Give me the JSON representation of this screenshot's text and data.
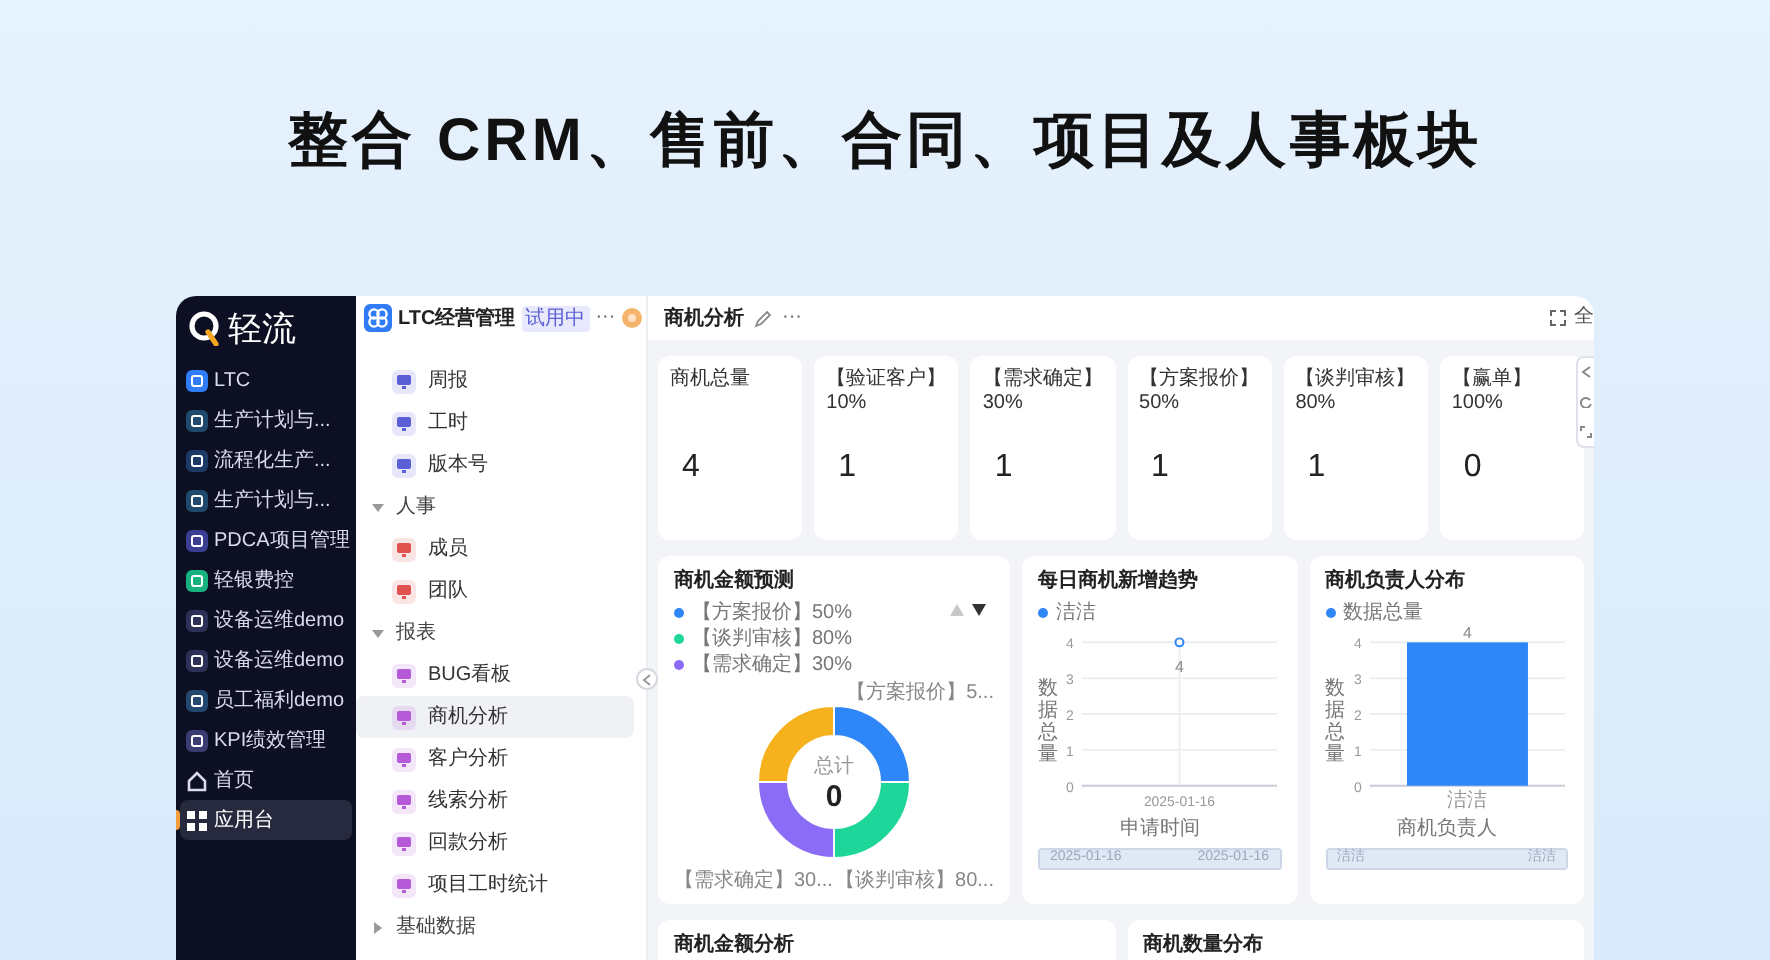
{
  "headline": "整合 CRM、售前、合同、项目及人事板块",
  "brand": "轻流",
  "apps": [
    {
      "label": "LTC",
      "kind": "app",
      "color": "#2f7cf6",
      "selected": false
    },
    {
      "label": "生产计划与...",
      "kind": "app",
      "color": "#1f4a6e",
      "selected": false
    },
    {
      "label": "流程化生产...",
      "kind": "app",
      "color": "#1c3a66",
      "selected": false
    },
    {
      "label": "生产计划与...",
      "kind": "app",
      "color": "#1f4a6e",
      "selected": false
    },
    {
      "label": "PDCA项目管理",
      "kind": "app",
      "color": "#3a3f93",
      "selected": false
    },
    {
      "label": "轻银费控",
      "kind": "app",
      "color": "#17b17f",
      "selected": false
    },
    {
      "label": "设备运维demo",
      "kind": "app",
      "color": "#2d3158",
      "selected": false
    },
    {
      "label": "设备运维demo",
      "kind": "app",
      "color": "#2d3158",
      "selected": false
    },
    {
      "label": "员工福利demo",
      "kind": "app",
      "color": "#23476e",
      "selected": false
    },
    {
      "label": "KPI绩效管理",
      "kind": "app",
      "color": "#3a3d72",
      "selected": false
    },
    {
      "label": "首页",
      "kind": "home",
      "selected": false
    },
    {
      "label": "应用台",
      "kind": "grid",
      "selected": true
    }
  ],
  "nav": {
    "title": "LTC经营管理",
    "badge": "试用中",
    "more": "···",
    "tree": [
      {
        "label": "周报",
        "kind": "item",
        "color": "#5b5fd6",
        "selected": false
      },
      {
        "label": "工时",
        "kind": "item",
        "color": "#5b5fd6",
        "selected": false
      },
      {
        "label": "版本号",
        "kind": "item",
        "color": "#5b5fd6",
        "selected": false
      },
      {
        "label": "人事",
        "kind": "group",
        "expanded": true,
        "children": [
          {
            "label": "成员",
            "kind": "item",
            "color": "#e0524f",
            "selected": false
          },
          {
            "label": "团队",
            "kind": "item",
            "color": "#e0524f",
            "selected": false
          }
        ]
      },
      {
        "label": "报表",
        "kind": "group",
        "expanded": true,
        "children": [
          {
            "label": "BUG看板",
            "kind": "item",
            "color": "#b55ad6",
            "selected": false
          },
          {
            "label": "商机分析",
            "kind": "item",
            "color": "#b55ad6",
            "selected": true
          },
          {
            "label": "客户分析",
            "kind": "item",
            "color": "#b55ad6",
            "selected": false
          },
          {
            "label": "线索分析",
            "kind": "item",
            "color": "#b55ad6",
            "selected": false
          },
          {
            "label": "回款分析",
            "kind": "item",
            "color": "#b55ad6",
            "selected": false
          },
          {
            "label": "项目工时统计",
            "kind": "item",
            "color": "#b55ad6",
            "selected": false
          }
        ]
      },
      {
        "label": "基础数据",
        "kind": "group",
        "expanded": false
      }
    ]
  },
  "main": {
    "title": "商机分析",
    "more": "···",
    "fullscreen": "全",
    "kpis": [
      {
        "title": "商机总量",
        "value": "4"
      },
      {
        "title": "【验证客户】10%",
        "value": "1"
      },
      {
        "title": "【需求确定】30%",
        "value": "1"
      },
      {
        "title": "【方案报价】50%",
        "value": "1"
      },
      {
        "title": "【谈判审核】80%",
        "value": "1"
      },
      {
        "title": "【赢单】100%",
        "value": "0"
      }
    ],
    "forecast": {
      "title": "商机金额预测",
      "pager_up_disabled": true,
      "legend": [
        {
          "label": "【方案报价】50%",
          "color": "#2f86f6"
        },
        {
          "label": "【谈判审核】80%",
          "color": "#1fd69a"
        },
        {
          "label": "【需求确定】30%",
          "color": "#8b6cf6"
        }
      ],
      "center_label": "总计",
      "center_value": "0",
      "slice_labels": [
        "【方案报价】5...",
        "【需求确定】30...",
        "【谈判审核】80..."
      ]
    },
    "trend": {
      "title": "每日商机新增趋势",
      "zoom_range": [
        "2025-01-16",
        "2025-01-16"
      ],
      "zoom_slider": {
        "level": 1
      },
      "chart_data": {
        "type": "line",
        "xlabel": "申请时间",
        "ylabel": "数据总量",
        "categories": [
          "2025-01-16"
        ],
        "series": [
          {
            "name": "洁洁",
            "color": "#2f86f6",
            "marker": true,
            "values": [
              4
            ]
          }
        ],
        "ylim": [
          0,
          4
        ],
        "yticks": [
          0,
          1,
          2,
          3,
          4
        ],
        "grid": true,
        "data_labels": true
      }
    },
    "owners": {
      "title": "商机负责人分布",
      "zoom_range": [
        "洁洁",
        "洁洁"
      ],
      "zoom_slider": {
        "level": 1
      },
      "chart_data": {
        "type": "bar",
        "xlabel": "商机负责人",
        "ylabel": "数据总量",
        "categories": [
          "洁洁"
        ],
        "series": [
          {
            "name": "数据总量",
            "color": "#2f86f6",
            "values": [
              4
            ]
          }
        ],
        "ylim": [
          0,
          4
        ],
        "yticks": [
          0,
          1,
          2,
          3,
          4
        ],
        "grid": true,
        "data_labels": true
      }
    },
    "bottom_cards": [
      "商机金额分析",
      "商机数量分布"
    ]
  }
}
